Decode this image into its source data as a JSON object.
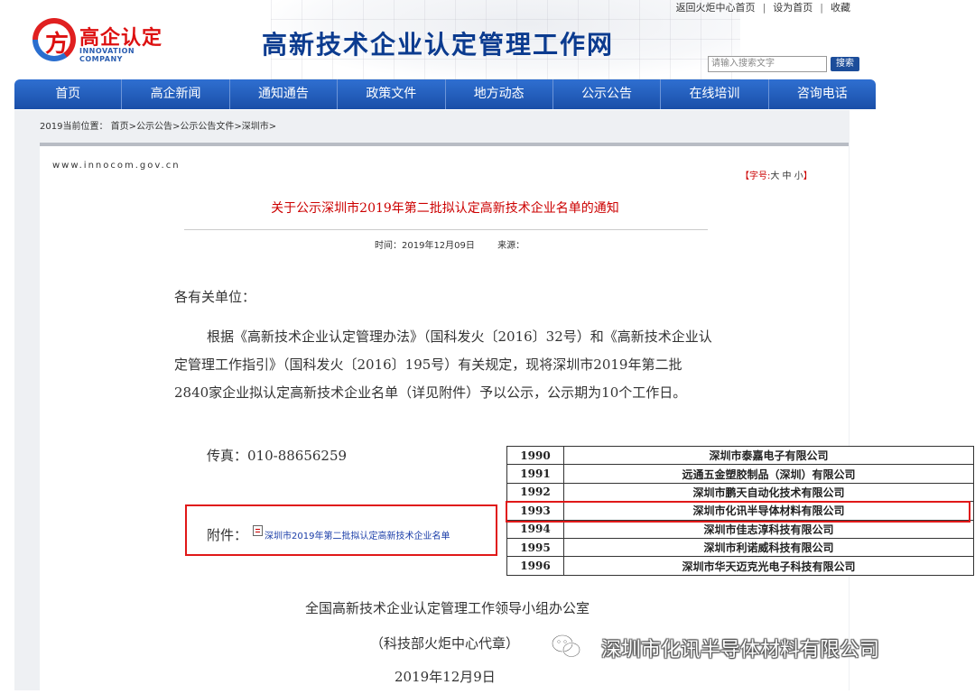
{
  "header": {
    "top_links": [
      "返回火炬中心首页",
      "设为首页",
      "收藏"
    ],
    "logo_glyph": "方",
    "logo_cn": "高企认定",
    "logo_en": "INNOVATION COMPANY",
    "site_title": "高新技术企业认定管理工作网",
    "search_placeholder": "请输入搜索文字",
    "search_button": "搜索"
  },
  "nav": [
    "首页",
    "高企新闻",
    "通知通告",
    "政策文件",
    "地方动态",
    "公示公告",
    "在线培训",
    "咨询电话"
  ],
  "breadcrumb": "2019当前位置： 首页>公示公告>公示公告文件>深圳市>",
  "article": {
    "domain": "www.innocom.gov.cn",
    "font_size_label": "【字号:",
    "font_size_options": "大 中 小",
    "font_size_end": "】",
    "title": "关于公示深圳市2019年第二批拟认定高新技术企业名单的通知",
    "time": "时间：2019年12月09日",
    "source": "来源：",
    "greeting": "各有关单位：",
    "paragraph": "根据《高新技术企业认定管理办法》（国科发火〔2016〕32号）和《高新技术企业认定管理工作指引》（国科发火〔2016〕195号）有关规定，现将深圳市2019年第二批2840家企业拟认定高新技术企业名单（详见附件）予以公示，公示期为10个工作日。",
    "fax": "传真：010-88656259",
    "attachment_label": "附件：",
    "attachment_link": "深圳市2019年第二批拟认定高新技术企业名单",
    "sign_office": "全国高新技术企业认定管理工作领导小组办公室",
    "sign_stamp": "（科技部火炬中心代章）",
    "sign_date": "2019年12月9日"
  },
  "table": {
    "rows": [
      {
        "num": "1990",
        "name": "深圳市泰嘉电子有限公司"
      },
      {
        "num": "1991",
        "name": "远通五金塑胶制品（深圳）有限公司"
      },
      {
        "num": "1992",
        "name": "深圳市鹏天自动化技术有限公司"
      },
      {
        "num": "1993",
        "name": "深圳市化讯半导体材料有限公司"
      },
      {
        "num": "1994",
        "name": "深圳市佳志淳科技有限公司"
      },
      {
        "num": "1995",
        "name": "深圳市利诺威科技有限公司"
      },
      {
        "num": "1996",
        "name": "深圳市华天迈克光电子科技有限公司"
      }
    ],
    "highlight_color": "#e01818"
  },
  "watermark": "深圳市化讯半导体材料有限公司",
  "colors": {
    "nav": "#1f58b5",
    "title_red": "#cc0000",
    "site_title": "#0b3b8f",
    "highlight": "#e01818"
  }
}
